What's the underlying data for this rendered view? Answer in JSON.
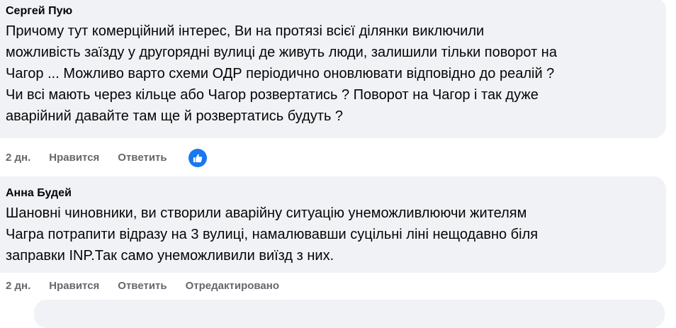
{
  "comments": [
    {
      "author": "Сергей Пую",
      "lines": [
        "Причому тут комерційний інтерес, Ви на протязі всієї ділянки виключили",
        "можливість заїзду у другорядні вулиці де живуть люди, залишили тільки поворот на",
        "Чагор ... Можливо варто схеми ОДР періодично оновлювати відповідно до реалій ?",
        "Чи всі мають через кільце або Чагор розвертатись ? Поворот на Чагор і так дуже",
        "аварійний давайте там ще й розвертатись будуть ?"
      ],
      "time": "2 дн.",
      "like_label": "Нравится",
      "reply_label": "Ответить",
      "reaction_icon": "like-thumb-icon"
    },
    {
      "author": "Анна Будей",
      "lines": [
        "Шановні чиновники, ви створили аварійну ситуацію унеможливлюючи жителям",
        "Чагра потрапити відразу на 3 вулиці, намалювавши суцільні ліні нещодавно біля",
        "заправки INP.Так само унеможливили виїзд з них."
      ],
      "time": "2 дн.",
      "like_label": "Нравится",
      "reply_label": "Ответить",
      "edited_label": "Отредактировано"
    }
  ],
  "colors": {
    "bubble_bg": "#f0f2f5",
    "meta_text": "#65676b",
    "like_blue": "#1877f2"
  }
}
